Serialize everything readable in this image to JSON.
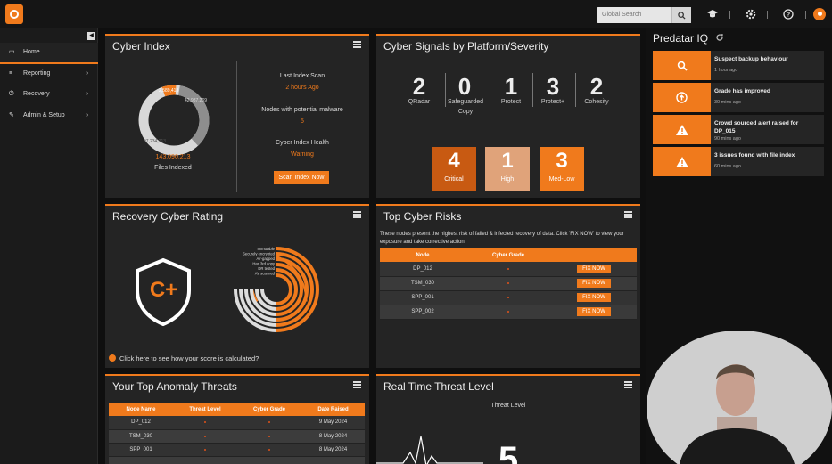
{
  "topbar": {
    "search_placeholder": "Global Search"
  },
  "sidebar": {
    "items": [
      {
        "label": "Home",
        "icon": "home-icon"
      },
      {
        "label": "Reporting",
        "icon": "report-icon"
      },
      {
        "label": "Recovery",
        "icon": "power-icon"
      },
      {
        "label": "Admin & Setup",
        "icon": "wrench-icon"
      }
    ]
  },
  "cyber_index": {
    "title": "Cyber Index",
    "donut_labels": [
      "2,589,413",
      "42,987,269",
      "97,234,213"
    ],
    "files_indexed_value": "143,090,213",
    "files_indexed_label": "Files Indexed",
    "last_scan_label": "Last Index Scan",
    "last_scan_value": "2 hours Ago",
    "malware_label": "Nodes with potential malware",
    "malware_value": "5",
    "health_label": "Cyber Index Health",
    "health_value": "Warning",
    "scan_button": "Scan Index Now"
  },
  "signals": {
    "title": "Cyber Signals by Platform/Severity",
    "platforms": [
      {
        "count": "2",
        "label": "QRadar"
      },
      {
        "count": "0",
        "label": "Safeguarded Copy"
      },
      {
        "count": "1",
        "label": "Protect"
      },
      {
        "count": "3",
        "label": "Protect+"
      },
      {
        "count": "2",
        "label": "Cohesity"
      }
    ],
    "severities": [
      {
        "count": "4",
        "label": "Critical",
        "color": "#c85a12"
      },
      {
        "count": "1",
        "label": "High",
        "color": "#e0a37a"
      },
      {
        "count": "3",
        "label": "Med-Low",
        "color": "#f07a1c"
      }
    ]
  },
  "predatar": {
    "title": "Predatar IQ",
    "cards": [
      {
        "icon": "search-icon",
        "title": "Suspect backup behaviour",
        "time": "1 hour ago"
      },
      {
        "icon": "arrow-up-circle-icon",
        "title": "Grade has improved",
        "time": "30 mins ago"
      },
      {
        "icon": "warning-icon",
        "title": "Crowd sourced alert raised for DP_015",
        "time": "90 mins ago"
      },
      {
        "icon": "warning-icon",
        "title": "3 issues found with file index",
        "time": "60 mins ago"
      }
    ]
  },
  "recovery_rating": {
    "title": "Recovery Cyber Rating",
    "grade": "C+",
    "rings": [
      "Immutable",
      "Securely encrypted",
      "Air-gapped",
      "Has 3rd copy",
      "DR tested",
      "AV scanned"
    ],
    "footer": "Click here to see how your score is calculated?"
  },
  "top_risks": {
    "title": "Top Cyber Risks",
    "description": "These nodes present the highest risk of failed & infected recovery of data. Click 'FIX NOW' to view your exposure and take corrective action.",
    "columns": [
      "Node",
      "Cyber Grade",
      ""
    ],
    "rows": [
      {
        "node": "DP_012",
        "action": "FIX NOW"
      },
      {
        "node": "TSM_030",
        "action": "FIX NOW"
      },
      {
        "node": "SPP_001",
        "action": "FIX NOW"
      },
      {
        "node": "SPP_002",
        "action": "FIX NOW"
      }
    ]
  },
  "anomaly": {
    "title": "Your Top Anomaly Threats",
    "columns": [
      "Node Name",
      "Threat Level",
      "Cyber Grade",
      "Date Raised"
    ],
    "rows": [
      {
        "node": "DP_012",
        "date": "9 May 2024"
      },
      {
        "node": "TSM_030",
        "date": "8 May 2024"
      },
      {
        "node": "SPP_001",
        "date": "8 May 2024"
      }
    ]
  },
  "threat_level": {
    "title": "Real Time Threat Level",
    "subtitle": "Threat Level",
    "value": "5"
  }
}
